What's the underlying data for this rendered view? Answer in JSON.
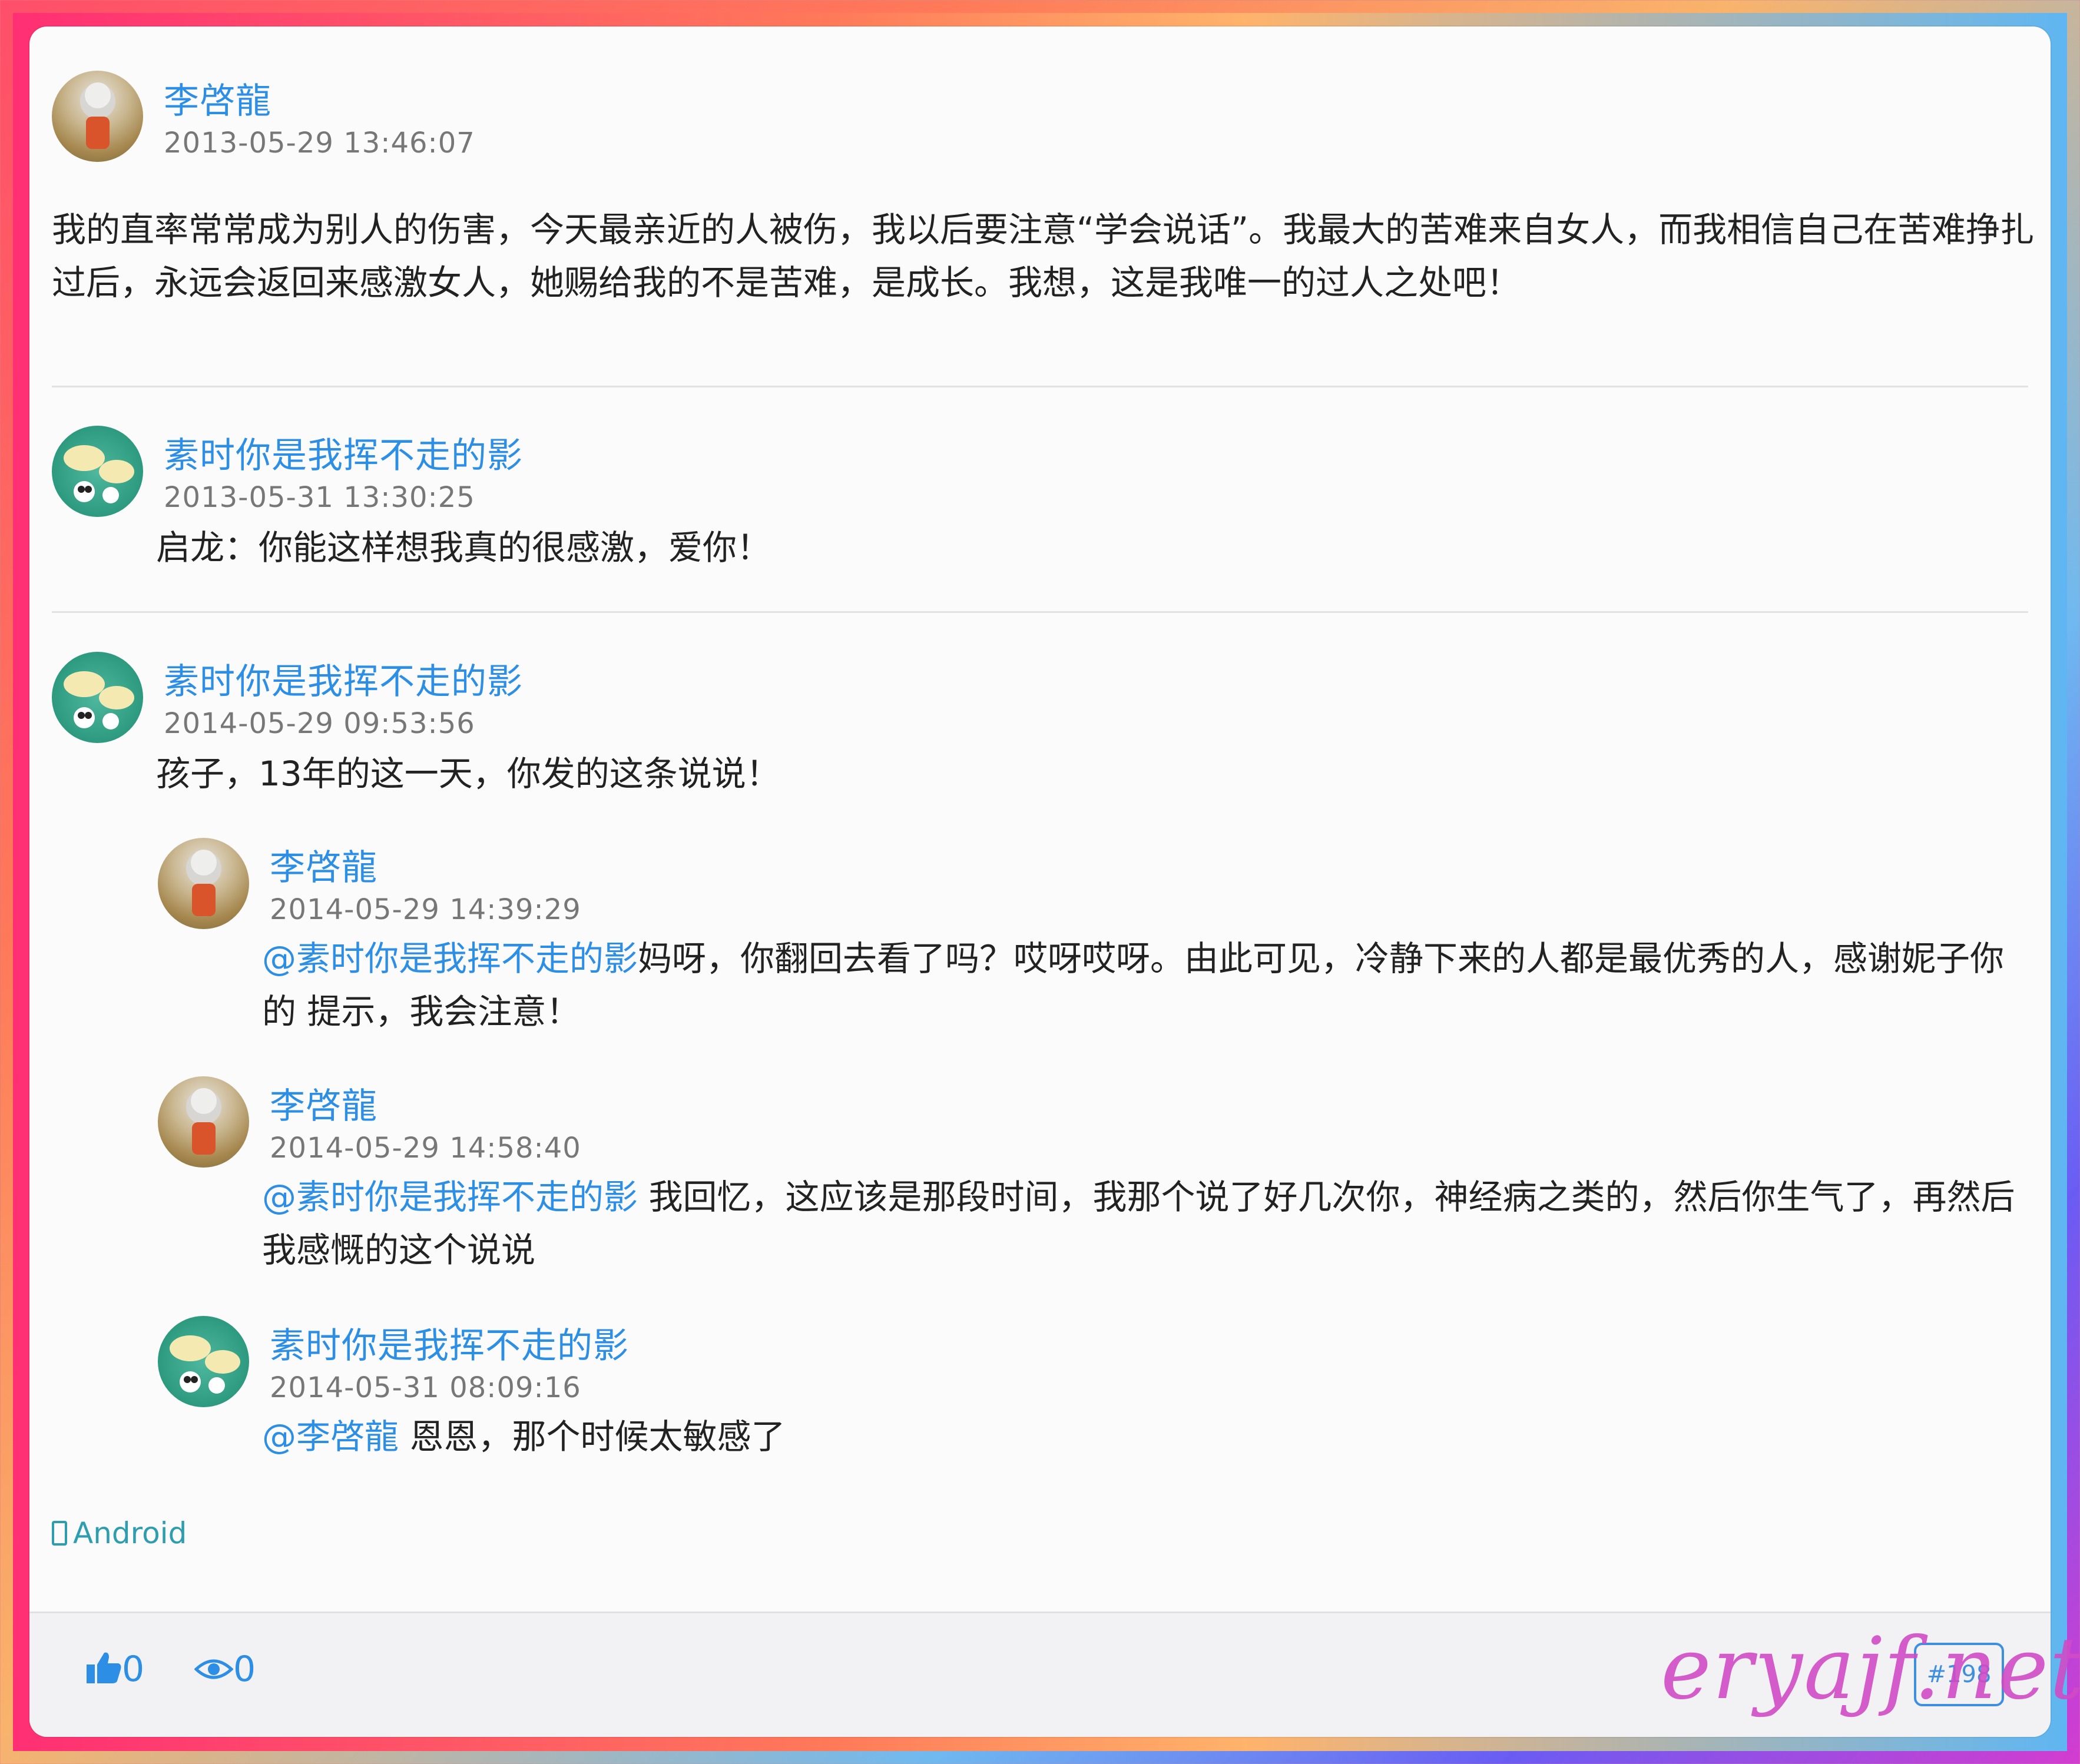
{
  "post": {
    "author": "李啓龍",
    "time": "2013-05-29 13:46:07",
    "text": "我的直率常常成为别人的伤害，今天最亲近的人被伤，我以后要注意“学会说话”。我最大的苦难来自女人，而我相信自己在苦难挣扎过后，永远会返回来感激女人，她赐给我的不是苦难，是成长。我想，这是我唯一的过人之处吧！"
  },
  "comments": [
    {
      "author": "素时你是我挥不走的影",
      "time": "2013-05-31 13:30:25",
      "text": "启龙：你能这样想我真的很感激，爱你！"
    },
    {
      "author": "素时你是我挥不走的影",
      "time": "2014-05-29 09:53:56",
      "text": "孩子，13年的这一天，你发的这条说说！"
    }
  ],
  "replies": [
    {
      "author": "李啓龍",
      "time": "2014-05-29 14:39:29",
      "mention": "@素时你是我挥不走的影",
      "text": "妈呀，你翻回去看了吗？哎呀哎呀。由此可见，冷静下来的人都是最优秀的人，感谢妮子你的 提示，我会注意！"
    },
    {
      "author": "李啓龍",
      "time": "2014-05-29 14:58:40",
      "mention": "@素时你是我挥不走的影",
      "text": " 我回忆，这应该是那段时间，我那个说了好几次你，神经病之类的，然后你生气了，再然后我感慨的这个说说"
    },
    {
      "author": "素时你是我挥不走的影",
      "time": "2014-05-31 08:09:16",
      "mention": "@李啓龍",
      "text": " 恩恩，那个时候太敏感了"
    }
  ],
  "source": "Android",
  "footer": {
    "likes": "0",
    "views": "0",
    "badge": "#198"
  },
  "watermark": "eryajf.net",
  "icons": {
    "source": "phone-icon",
    "like": "thumbs-up-icon",
    "view": "eye-icon"
  }
}
